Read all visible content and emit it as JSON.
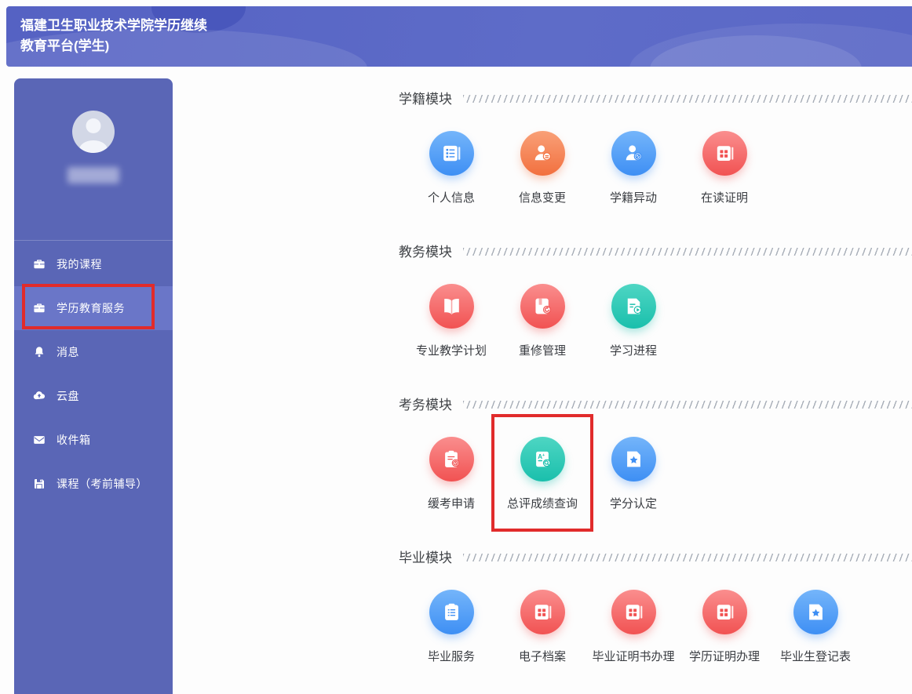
{
  "header": {
    "title": "福建卫生职业技术学院学历继续教育平台(学生)"
  },
  "sidebar": {
    "items": [
      {
        "id": "my-courses",
        "label": "我的课程",
        "icon": "briefcase-icon",
        "active": false,
        "annotated": false
      },
      {
        "id": "degree-education-services",
        "label": "学历教育服务",
        "icon": "briefcase-icon",
        "active": true,
        "annotated": true
      },
      {
        "id": "messages",
        "label": "消息",
        "icon": "bell-icon",
        "active": false,
        "annotated": false
      },
      {
        "id": "cloud-drive",
        "label": "云盘",
        "icon": "cloud-upload-icon",
        "active": false,
        "annotated": false
      },
      {
        "id": "inbox",
        "label": "收件箱",
        "icon": "envelope-icon",
        "active": false,
        "annotated": false
      },
      {
        "id": "pre-exam-tutoring-courses",
        "label": "课程（考前辅导）",
        "icon": "disk-icon",
        "active": false,
        "annotated": false
      }
    ]
  },
  "sections": [
    {
      "id": "student-status-module",
      "title": "学籍模块",
      "items": [
        {
          "id": "personal-info",
          "label": "个人信息",
          "color": "blue",
          "icon": "notebook-icon",
          "annotated": false
        },
        {
          "id": "info-change",
          "label": "信息变更",
          "color": "orange",
          "icon": "person-edit-icon",
          "annotated": false
        },
        {
          "id": "status-change",
          "label": "学籍异动",
          "color": "blue",
          "icon": "person-status-icon",
          "annotated": false
        },
        {
          "id": "enrollment-certificate",
          "label": "在读证明",
          "color": "red",
          "icon": "book-grid-icon",
          "annotated": false
        }
      ]
    },
    {
      "id": "academic-affairs-module",
      "title": "教务模块",
      "items": [
        {
          "id": "major-teaching-plan",
          "label": "专业教学计划",
          "color": "red",
          "icon": "open-book-icon",
          "annotated": false
        },
        {
          "id": "retake-management",
          "label": "重修管理",
          "color": "red",
          "icon": "book-redo-icon",
          "annotated": false
        },
        {
          "id": "learning-progress",
          "label": "学习进程",
          "color": "teal",
          "icon": "doc-play-icon",
          "annotated": false
        }
      ]
    },
    {
      "id": "exam-affairs-module",
      "title": "考务模块",
      "items": [
        {
          "id": "deferred-exam-application",
          "label": "缓考申请",
          "color": "red",
          "icon": "clipboard-clock-icon",
          "annotated": false
        },
        {
          "id": "final-score-query",
          "label": "总评成绩查询",
          "color": "teal",
          "icon": "score-search-icon",
          "annotated": true
        },
        {
          "id": "credit-recognition",
          "label": "学分认定",
          "color": "blue",
          "icon": "page-star-icon",
          "annotated": false
        }
      ]
    },
    {
      "id": "graduation-module",
      "title": "毕业模块",
      "items": [
        {
          "id": "graduation-services",
          "label": "毕业服务",
          "color": "blue",
          "icon": "clipboard-list-icon",
          "annotated": false
        },
        {
          "id": "electronic-archives",
          "label": "电子档案",
          "color": "red",
          "icon": "book-grid-icon",
          "annotated": false
        },
        {
          "id": "graduation-certificate",
          "label": "毕业证明书办理",
          "color": "red",
          "icon": "book-grid-icon",
          "annotated": false
        },
        {
          "id": "degree-certificate",
          "label": "学历证明办理",
          "color": "red",
          "icon": "book-grid-icon",
          "annotated": false
        },
        {
          "id": "graduate-registration",
          "label": "毕业生登记表",
          "color": "blue",
          "icon": "page-star-icon",
          "annotated": false
        }
      ]
    }
  ],
  "colors": {
    "header": "#5b68c4",
    "sidebar": "#5a66b6",
    "sidebar_active": "#6a76c8",
    "annotation_red": "#e12b2b",
    "blue": {
      "light": "#74b5fa",
      "dark": "#3e8ff4",
      "shadow": "rgba(62,143,244,0.40)"
    },
    "orange": {
      "light": "#f9a077",
      "dark": "#f2703f",
      "shadow": "rgba(242,112,63,0.40)"
    },
    "red": {
      "light": "#fa8e8e",
      "dark": "#f15252",
      "shadow": "rgba(241,82,82,0.40)"
    },
    "teal": {
      "light": "#4ed6c3",
      "dark": "#1abfac",
      "shadow": "rgba(26,191,172,0.40)"
    }
  }
}
